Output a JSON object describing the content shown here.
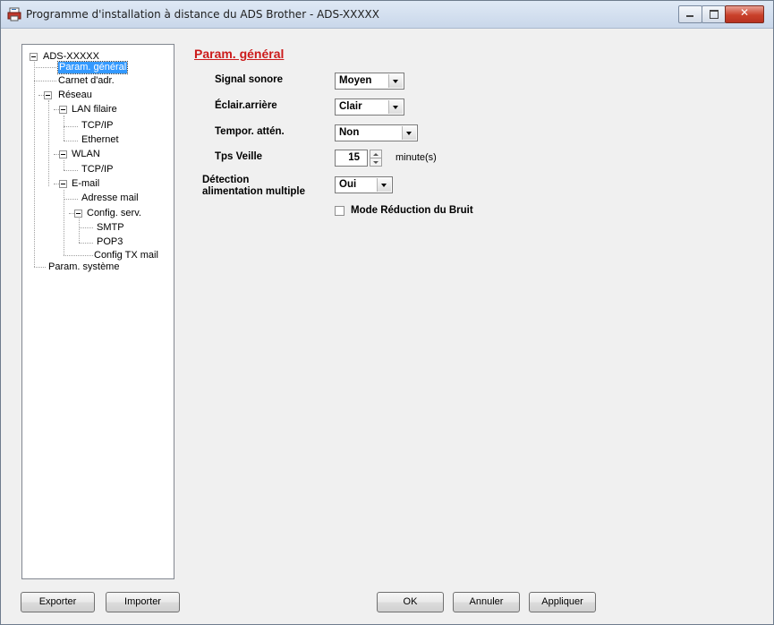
{
  "window": {
    "title": "Programme d'installation à distance du ADS Brother - ADS-XXXXX",
    "controls": {
      "minimize": "–",
      "maximize": "□",
      "close": "✕"
    }
  },
  "tree": {
    "root": "ADS-XXXXX",
    "param_general": "Param. général",
    "carnet": "Carnet d'adr.",
    "reseau": "Réseau",
    "lan_filaire": "LAN filaire",
    "lan_tcpip": "TCP/IP",
    "ethernet": "Ethernet",
    "wlan": "WLAN",
    "wlan_tcpip": "TCP/IP",
    "email": "E-mail",
    "adresse_mail": "Adresse mail",
    "config_serv": "Config. serv.",
    "smtp": "SMTP",
    "pop3": "POP3",
    "config_tx": "Config TX mail",
    "param_systeme": "Param. système",
    "selected": "param_general"
  },
  "main": {
    "title": "Param. général",
    "signal_sonore": {
      "label": "Signal sonore",
      "value": "Moyen"
    },
    "eclair_arriere": {
      "label": "Éclair.arrière",
      "value": "Clair"
    },
    "tempor_atten": {
      "label": "Tempor. attén.",
      "value": "Non"
    },
    "tps_veille": {
      "label": "Tps Veille",
      "value": "15",
      "unit": "minute(s)"
    },
    "detection": {
      "label_line1": "Détection",
      "label_line2": "alimentation multiple",
      "value": "Oui"
    },
    "mode_reduction": {
      "label": "Mode Réduction du Bruit",
      "checked": false
    }
  },
  "buttons": {
    "exporter": "Exporter",
    "importer": "Importer",
    "ok": "OK",
    "annuler": "Annuler",
    "appliquer": "Appliquer"
  }
}
